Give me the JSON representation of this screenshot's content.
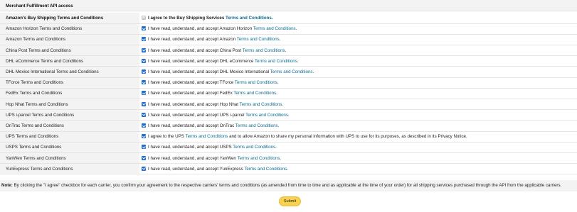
{
  "section_title": "Merchant Fulfillment API access",
  "rows": [
    {
      "label": "Amazon's Buy Shipping Terms and Conditions",
      "pre": "I agree to the Buy Shipping Services ",
      "link": "Terms and Conditions",
      "post": ".",
      "checked": true,
      "disabled": true,
      "bold": true
    },
    {
      "label": "Amazon Horizon Terms and Conditions",
      "pre": "I have read, understand, and accept Amazon Horizon ",
      "link": "Terms and Conditions",
      "post": ".",
      "checked": true,
      "disabled": false,
      "bold": false
    },
    {
      "label": "Amazon Terms and Conditions",
      "pre": "I have read, understand, and accept Amazon ",
      "link": "Terms and Conditions",
      "post": ".",
      "checked": true,
      "disabled": false,
      "bold": false
    },
    {
      "label": "China Post Terms and Conditions",
      "pre": "I have read, understand, and accept China Post ",
      "link": "Terms and Conditions",
      "post": ".",
      "checked": true,
      "disabled": false,
      "bold": false
    },
    {
      "label": "DHL eCommerce Terms and Conditions",
      "pre": "I have read, understand, and accept DHL eCommerce ",
      "link": "Terms and Conditions",
      "post": ".",
      "checked": true,
      "disabled": false,
      "bold": false
    },
    {
      "label": "DHL Mexico International Terms and Conditions",
      "pre": "I have read, understand, and accept DHL Mexico International ",
      "link": "Terms and Conditions",
      "post": ".",
      "checked": true,
      "disabled": false,
      "bold": false
    },
    {
      "label": "TForce Terms and Conditions",
      "pre": "I have read, understand, and accept TForce ",
      "link": "Terms and Conditions",
      "post": ".",
      "checked": true,
      "disabled": false,
      "bold": false
    },
    {
      "label": "FedEx Terms and Conditions",
      "pre": "I have read, understand, and accept FedEx ",
      "link": "Terms and Conditions",
      "post": ".",
      "checked": true,
      "disabled": false,
      "bold": false
    },
    {
      "label": "Hop Nhat Terms and Conditions",
      "pre": "I have read, understand, and accept Hop Nhat ",
      "link": "Terms and Conditions",
      "post": ".",
      "checked": true,
      "disabled": false,
      "bold": false
    },
    {
      "label": "UPS i-parcel Terms and Conditions",
      "pre": "I have read, understand, and accept UPS i-parcel ",
      "link": "Terms and Conditions",
      "post": ".",
      "checked": true,
      "disabled": false,
      "bold": false
    },
    {
      "label": "OnTrac Terms and Conditions",
      "pre": "I have read, understand, and accept OnTrac ",
      "link": "Terms and Conditions",
      "post": ".",
      "checked": true,
      "disabled": false,
      "bold": false
    },
    {
      "label": "UPS Terms and Conditions",
      "pre": "I agree to the UPS ",
      "link": "Terms and Conditions",
      "post": " and to allow Amazon to share my personal information with UPS to use for its purposes, as described in its Privacy Notice.",
      "checked": true,
      "disabled": false,
      "bold": false
    },
    {
      "label": "USPS Terms and Conditions",
      "pre": "I have read, understand, and accept USPS ",
      "link": "Terms and Conditions",
      "post": ".",
      "checked": true,
      "disabled": false,
      "bold": false
    },
    {
      "label": "YanWen Terms and Conditions",
      "pre": "I have read, understand, and accept YanWen ",
      "link": "Terms and Conditions",
      "post": ".",
      "checked": true,
      "disabled": false,
      "bold": false
    },
    {
      "label": "YunExpress Terms and Conditions",
      "pre": "I have read, understand, and accept YunExpress ",
      "link": "Terms and Conditions",
      "post": ".",
      "checked": true,
      "disabled": false,
      "bold": false
    }
  ],
  "note": {
    "label": "Note:",
    "text": " By clicking the \"I agree\" checkbox for each carrier, you confirm your agreement to the respective carriers' terms and conditions (as amended from time to time and as applicable at the time of your order) for all shipping services purchased through the API from the applicable carriers."
  },
  "submit_label": "Submit",
  "colors": {
    "accent": "#1f6fd1",
    "link": "#0b6b8f",
    "button": "#f7d14f"
  }
}
